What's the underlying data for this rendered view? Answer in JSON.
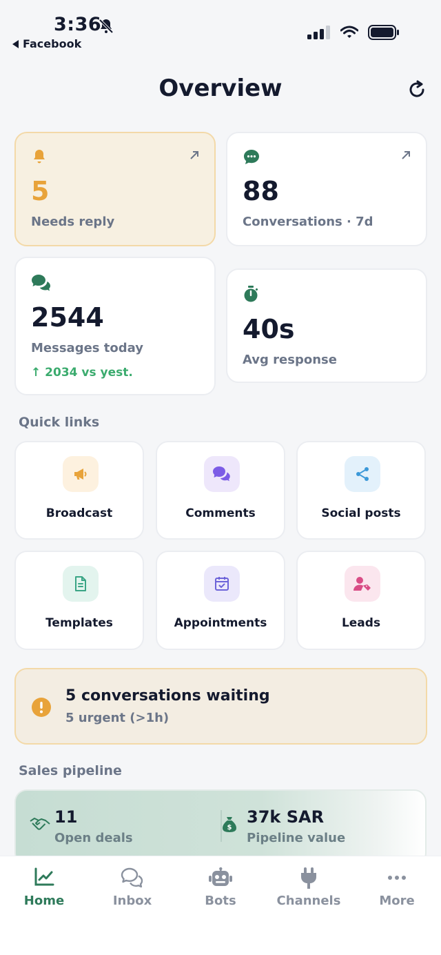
{
  "status_bar": {
    "time": "3:36",
    "back_label": "Facebook"
  },
  "header": {
    "title": "Overview"
  },
  "stats": [
    {
      "value": "5",
      "label": "Needs reply",
      "icon": "bell-icon"
    },
    {
      "value": "88",
      "label": "Conversations · 7d",
      "icon": "chat-bubble-icon"
    },
    {
      "value": "2544",
      "label": "Messages today",
      "trend": "↑ 2034 vs yest.",
      "icon": "chats-icon"
    },
    {
      "value": "40s",
      "label": "Avg response",
      "icon": "stopwatch-icon"
    }
  ],
  "quick_links": {
    "title": "Quick links",
    "items": [
      {
        "label": "Broadcast",
        "icon": "megaphone-icon"
      },
      {
        "label": "Comments",
        "icon": "comments-icon"
      },
      {
        "label": "Social posts",
        "icon": "share-icon"
      },
      {
        "label": "Templates",
        "icon": "document-icon"
      },
      {
        "label": "Appointments",
        "icon": "calendar-check-icon"
      },
      {
        "label": "Leads",
        "icon": "user-tag-icon"
      }
    ]
  },
  "alert": {
    "title": "5 conversations waiting",
    "subtitle": "5 urgent (>1h)"
  },
  "pipeline": {
    "title": "Sales pipeline",
    "open_deals_value": "11",
    "open_deals_label": "Open deals",
    "pipeline_value": "37k SAR",
    "pipeline_label": "Pipeline value"
  },
  "tabs": [
    {
      "label": "Home",
      "active": true
    },
    {
      "label": "Inbox"
    },
    {
      "label": "Bots"
    },
    {
      "label": "Channels"
    },
    {
      "label": "More"
    }
  ],
  "colors": {
    "accent_green": "#2e7a5a",
    "amber": "#e8a33a",
    "trend_green": "#3bab6e",
    "muted": "#6b7588"
  }
}
